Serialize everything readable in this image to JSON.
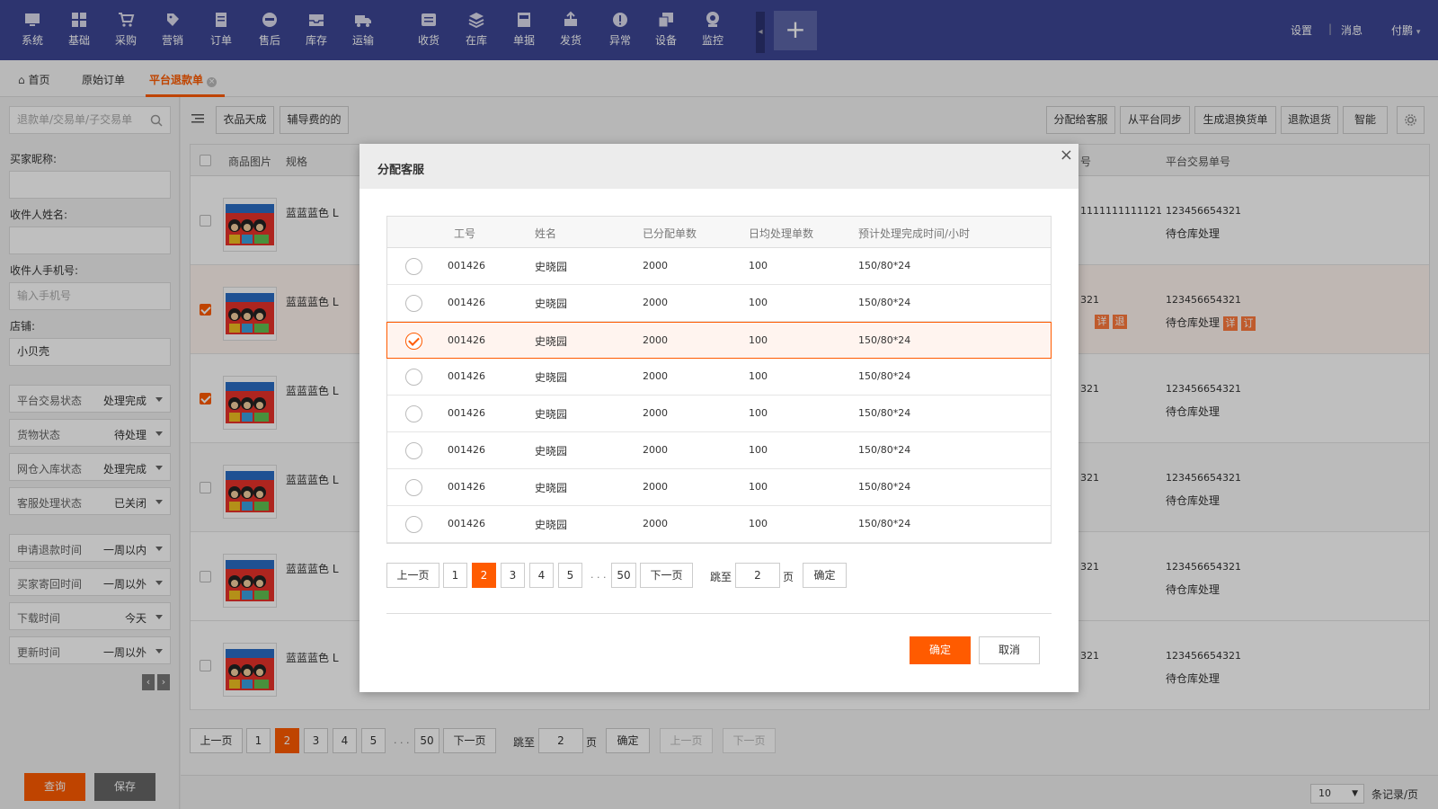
{
  "nav": {
    "items": [
      {
        "label": "系统",
        "icon": "monitor-icon"
      },
      {
        "label": "基础",
        "icon": "grid-icon"
      },
      {
        "label": "采购",
        "icon": "cart-icon"
      },
      {
        "label": "营销",
        "icon": "tag-icon"
      },
      {
        "label": "订单",
        "icon": "document-icon"
      },
      {
        "label": "售后",
        "icon": "service-icon"
      },
      {
        "label": "库存",
        "icon": "inbox-icon"
      },
      {
        "label": "运输",
        "icon": "truck-icon"
      },
      {
        "label": "收货",
        "icon": "receive-icon"
      },
      {
        "label": "在库",
        "icon": "stack-icon"
      },
      {
        "label": "单据",
        "icon": "receipt-icon"
      },
      {
        "label": "发货",
        "icon": "ship-icon"
      },
      {
        "label": "异常",
        "icon": "alert-icon"
      },
      {
        "label": "设备",
        "icon": "device-icon"
      },
      {
        "label": "监控",
        "icon": "camera-icon"
      }
    ],
    "collapse_icon": "◂",
    "plus": "+",
    "settings": "设置",
    "divider": "|",
    "messages": "消息",
    "user": "付鹏"
  },
  "tabs": {
    "home": "首页",
    "original_orders": "原始订单",
    "refund": "平台退款单"
  },
  "sidebar": {
    "search_placeholder": "退款单/交易单/子交易单",
    "buyer_nick_label": "买家昵称:",
    "recipient_name_label": "收件人姓名:",
    "recipient_phone_label": "收件人手机号:",
    "phone_placeholder": "输入手机号",
    "store_label": "店铺:",
    "store_value": "小贝壳",
    "filters": [
      {
        "key": "平台交易状态",
        "value": "处理完成"
      },
      {
        "key": "货物状态",
        "value": "待处理"
      },
      {
        "key": "网仓入库状态",
        "value": "处理完成"
      },
      {
        "key": "客服处理状态",
        "value": "已关闭"
      },
      {
        "key": "申请退款时间",
        "value": "一周以内"
      },
      {
        "key": "买家寄回时间",
        "value": "一周以外"
      },
      {
        "key": "下载时间",
        "value": "今天"
      },
      {
        "key": "更新时间",
        "value": "一周以外"
      }
    ],
    "query_btn": "查询",
    "save_btn": "保存"
  },
  "toolbar": {
    "store1": "衣品天成",
    "store2": "辅导费的的",
    "assign": "分配给客服",
    "sync": "从平台同步",
    "gen": "生成退换货单",
    "refund": "退款退货",
    "smart": "智能"
  },
  "grid": {
    "headers": {
      "image": "商品图片",
      "spec": "规格",
      "col_no": "号",
      "trade_no": "平台交易单号"
    },
    "rows": [
      {
        "spec": "蓝蓝蓝色 L",
        "partial": "1111111111121",
        "trade": "123456654321",
        "status": "待仓库处理",
        "checked": false,
        "tags": []
      },
      {
        "spec": "蓝蓝蓝色 L",
        "partial": "321",
        "trade": "123456654321",
        "status": "待仓库处理",
        "checked": true,
        "tags": [
          "详",
          "订"
        ],
        "partial_tags": [
          "详",
          "退"
        ]
      },
      {
        "spec": "蓝蓝蓝色 L",
        "partial": "321",
        "trade": "123456654321",
        "status": "待仓库处理",
        "checked": true,
        "tags": []
      },
      {
        "spec": "蓝蓝蓝色 L",
        "partial": "321",
        "trade": "123456654321",
        "status": "待仓库处理",
        "checked": false,
        "tags": []
      },
      {
        "spec": "蓝蓝蓝色 L",
        "partial": "321",
        "trade": "123456654321",
        "status": "待仓库处理",
        "checked": false,
        "tags": []
      },
      {
        "spec": "蓝蓝蓝色 L",
        "partial": "321",
        "trade": "123456654321",
        "status": "待仓库处理",
        "checked": false,
        "tags": []
      }
    ]
  },
  "pager": {
    "prev": "上一页",
    "next": "下一页",
    "pages": [
      "1",
      "2",
      "3",
      "4",
      "5"
    ],
    "ellipsis": ". . .",
    "last": "50",
    "current": "2",
    "jump_label": "跳至",
    "jump_value": "2",
    "page_unit": "页",
    "confirm": "确定"
  },
  "footer": {
    "per_page": "10",
    "per_page_label": "条记录/页"
  },
  "modal": {
    "title": "分配客服",
    "close": "×",
    "headers": {
      "id": "工号",
      "name": "姓名",
      "assigned": "已分配单数",
      "daily": "日均处理单数",
      "eta": "预计处理完成时间/小时"
    },
    "rows": [
      {
        "id": "001426",
        "name": "史晓园",
        "assigned": "2000",
        "daily": "100",
        "eta": "150/80*24",
        "selected": false
      },
      {
        "id": "001426",
        "name": "史晓园",
        "assigned": "2000",
        "daily": "100",
        "eta": "150/80*24",
        "selected": false
      },
      {
        "id": "001426",
        "name": "史晓园",
        "assigned": "2000",
        "daily": "100",
        "eta": "150/80*24",
        "selected": true
      },
      {
        "id": "001426",
        "name": "史晓园",
        "assigned": "2000",
        "daily": "100",
        "eta": "150/80*24",
        "selected": false
      },
      {
        "id": "001426",
        "name": "史晓园",
        "assigned": "2000",
        "daily": "100",
        "eta": "150/80*24",
        "selected": false
      },
      {
        "id": "001426",
        "name": "史晓园",
        "assigned": "2000",
        "daily": "100",
        "eta": "150/80*24",
        "selected": false
      },
      {
        "id": "001426",
        "name": "史晓园",
        "assigned": "2000",
        "daily": "100",
        "eta": "150/80*24",
        "selected": false
      },
      {
        "id": "001426",
        "name": "史晓园",
        "assigned": "2000",
        "daily": "100",
        "eta": "150/80*24",
        "selected": false
      }
    ],
    "ok": "确定",
    "cancel": "取消"
  },
  "colors": {
    "primary": "#3c4694",
    "accent": "#ff5b00"
  }
}
